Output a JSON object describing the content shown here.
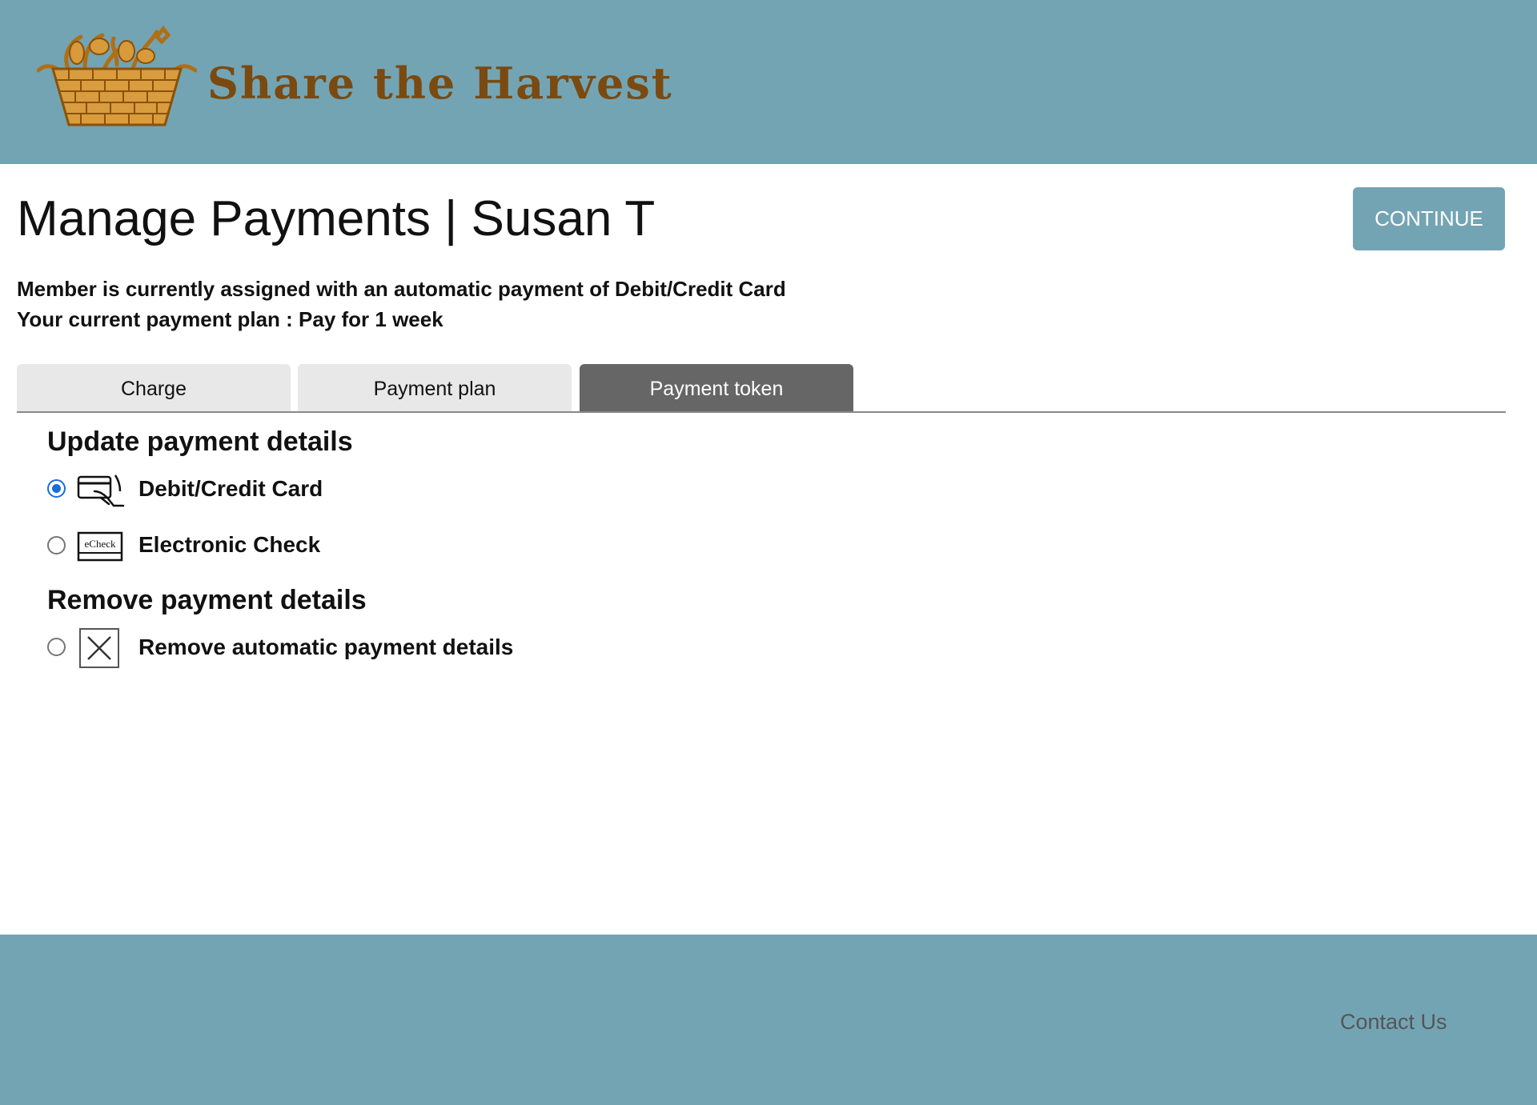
{
  "header": {
    "brand": "Share the Harvest",
    "logo_icon": "harvest-basket-icon",
    "background": "#73a4b4"
  },
  "page": {
    "title": "Manage Payments | Susan T",
    "continue_label": "CONTINUE"
  },
  "info": {
    "line1": "Member is currently assigned with an automatic payment of Debit/Credit Card",
    "line2": "Your current payment plan : Pay for 1 week"
  },
  "tabs": [
    {
      "label": "Charge",
      "active": false
    },
    {
      "label": "Payment plan",
      "active": false
    },
    {
      "label": "Payment token",
      "active": true
    }
  ],
  "update_section": {
    "heading": "Update payment details",
    "options": [
      {
        "label": "Debit/Credit Card",
        "icon": "card-in-hand-icon",
        "selected": true
      },
      {
        "label": "Electronic Check",
        "icon": "echeck-icon",
        "icon_text": "eCheck",
        "selected": false
      }
    ]
  },
  "remove_section": {
    "heading": "Remove payment details",
    "options": [
      {
        "label": "Remove automatic payment details",
        "icon": "x-box-icon",
        "selected": false
      }
    ]
  },
  "footer": {
    "contact": "Contact Us"
  }
}
